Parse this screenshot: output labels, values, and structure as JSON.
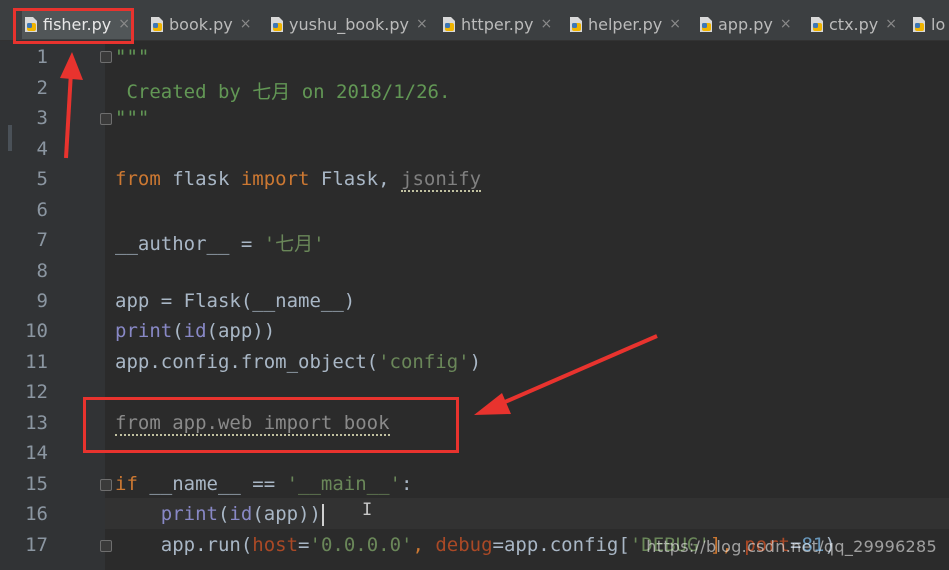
{
  "tabs": [
    {
      "label": "fisher.py",
      "active": true
    },
    {
      "label": "book.py"
    },
    {
      "label": "yushu_book.py"
    },
    {
      "label": "httper.py"
    },
    {
      "label": "helper.py"
    },
    {
      "label": "app.py"
    },
    {
      "label": "ctx.py"
    },
    {
      "label": "lo"
    }
  ],
  "close_glyph": "×",
  "line_numbers": [
    "1",
    "2",
    "3",
    "4",
    "5",
    "6",
    "7",
    "8",
    "9",
    "10",
    "11",
    "12",
    "13",
    "14",
    "15",
    "16",
    "17"
  ],
  "code": {
    "l1": "\"\"\"",
    "l2": " Created by 七月 on 2018/1/26.",
    "l3": "\"\"\"",
    "l5_from": "from",
    "l5_mod": " flask ",
    "l5_import": "import",
    "l5_names": " Flask, ",
    "l5_unused": "jsonify",
    "l7_name": "__author__ = ",
    "l7_str": "'七月'",
    "l9": "app = Flask(__name__)",
    "l10_print": "print",
    "l10_open": "(",
    "l10_id": "id",
    "l10_rest": "(app))",
    "l11_a": "app.config.from_object(",
    "l11_str": "'config'",
    "l11_b": ")",
    "l13": "from app.web import book",
    "l15_if": "if",
    "l15_mid": " __name__ == ",
    "l15_str": "'__main__'",
    "l15_end": ":",
    "l16_indent": "    ",
    "l16_print": "print",
    "l16_open": "(",
    "l16_id": "id",
    "l16_rest": "(app))",
    "l17_a": "    app.run(",
    "l17_host": "host",
    "l17_eq1": "=",
    "l17_hv": "'0.0.0.0'",
    "l17_c1": ", ",
    "l17_debug": "debug",
    "l17_eq2": "=app.config[",
    "l17_dv": "'DEBUG'",
    "l17_c2": "], ",
    "l17_port": "port",
    "l17_eq3": "=",
    "l17_pv": "81",
    "l17_end": ")"
  },
  "watermark": "https://blog.csdn.net/qq_29996285",
  "colors": {
    "annotation": "#e8332e",
    "keyword": "#cc7832",
    "string": "#6a8759"
  }
}
